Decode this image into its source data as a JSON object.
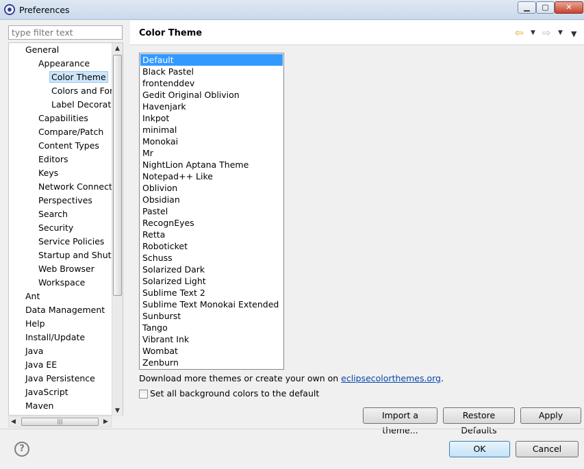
{
  "window": {
    "title": "Preferences",
    "controls": {
      "minimize": "▁",
      "maximize": "▢",
      "close": "✕"
    }
  },
  "sidebar": {
    "filter_placeholder": "type filter text",
    "items": [
      {
        "label": "General",
        "level": 1
      },
      {
        "label": "Appearance",
        "level": 2
      },
      {
        "label": "Color Theme",
        "level": 3,
        "selected": true
      },
      {
        "label": "Colors and Fonts",
        "level": 3
      },
      {
        "label": "Label Decorations",
        "level": 3
      },
      {
        "label": "Capabilities",
        "level": 2
      },
      {
        "label": "Compare/Patch",
        "level": 2
      },
      {
        "label": "Content Types",
        "level": 2
      },
      {
        "label": "Editors",
        "level": 2
      },
      {
        "label": "Keys",
        "level": 2
      },
      {
        "label": "Network Connections",
        "level": 2
      },
      {
        "label": "Perspectives",
        "level": 2
      },
      {
        "label": "Search",
        "level": 2
      },
      {
        "label": "Security",
        "level": 2
      },
      {
        "label": "Service Policies",
        "level": 2
      },
      {
        "label": "Startup and Shutdown",
        "level": 2
      },
      {
        "label": "Web Browser",
        "level": 2
      },
      {
        "label": "Workspace",
        "level": 2
      },
      {
        "label": "Ant",
        "level": 1
      },
      {
        "label": "Data Management",
        "level": 1
      },
      {
        "label": "Help",
        "level": 1
      },
      {
        "label": "Install/Update",
        "level": 1
      },
      {
        "label": "Java",
        "level": 1
      },
      {
        "label": "Java EE",
        "level": 1
      },
      {
        "label": "Java Persistence",
        "level": 1
      },
      {
        "label": "JavaScript",
        "level": 1
      },
      {
        "label": "Maven",
        "level": 1
      }
    ]
  },
  "main": {
    "title": "Color Theme",
    "themes": [
      "Default",
      "Black Pastel",
      "frontenddev",
      "Gedit Original Oblivion",
      "Havenjark",
      "Inkpot",
      "minimal",
      "Monokai",
      "Mr",
      "NightLion Aptana Theme",
      "Notepad++ Like",
      "Oblivion",
      "Obsidian",
      "Pastel",
      "RecognEyes",
      "Retta",
      "Roboticket",
      "Schuss",
      "Solarized Dark",
      "Solarized Light",
      "Sublime Text 2",
      "Sublime Text Monokai Extended",
      "Sunburst",
      "Tango",
      "Vibrant Ink",
      "Wombat",
      "Zenburn"
    ],
    "selected_theme": "Default",
    "download_prefix": "Download more themes or create your own on ",
    "download_link": "eclipsecolorthemes.org",
    "download_suffix": ".",
    "checkbox_label": "Set all background colors to the default",
    "checkbox_checked": false,
    "buttons": {
      "import": "Import a theme...",
      "restore": "Restore Defaults",
      "apply": "Apply"
    }
  },
  "footer": {
    "help_icon": "?",
    "ok": "OK",
    "cancel": "Cancel"
  }
}
